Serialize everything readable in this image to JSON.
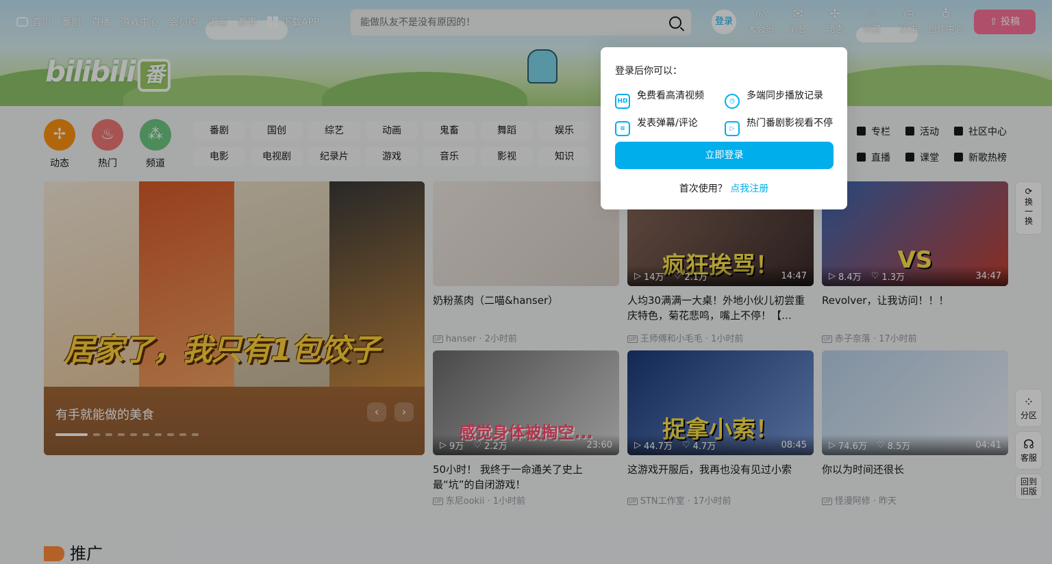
{
  "nav": {
    "home": "首页",
    "bangumi": "番剧",
    "live": "直播",
    "game": "游戏中心",
    "vipshop": "会员购",
    "manga": "漫画",
    "match": "赛事",
    "download": "下载APP"
  },
  "search": {
    "placeholder": "能做队友不是没有原因的！"
  },
  "right_nav": {
    "login": "登录",
    "vip": "大会员",
    "message": "消息",
    "dynamic": "动态",
    "favorite": "收藏",
    "history": "历史",
    "creator": "创作中心",
    "upload": "投稿"
  },
  "logo": {
    "text": "bilibili",
    "fan": "番"
  },
  "channels": [
    {
      "label": "动态",
      "color": "#ff9212"
    },
    {
      "label": "热门",
      "color": "#f07775"
    },
    {
      "label": "频道",
      "color": "#6dc781"
    }
  ],
  "tags": [
    "番剧",
    "国创",
    "综艺",
    "动画",
    "鬼畜",
    "舞蹈",
    "娱乐",
    "电影",
    "电视剧",
    "纪录片",
    "游戏",
    "音乐",
    "影视",
    "知识"
  ],
  "right_links": [
    "专栏",
    "活动",
    "社区中心",
    "直播",
    "课堂",
    "新歌热榜"
  ],
  "carousel": {
    "title": "有手就能做的美食",
    "caption": "居家了，我只有1包饺子"
  },
  "videos": [
    {
      "title": "奶粉蒸肉（二喵&hanser）",
      "author": "hanser",
      "time": "2小时前",
      "plays": "",
      "likes": "",
      "duration": "",
      "caption": ""
    },
    {
      "title": "人均30满满一大桌！外地小伙儿初尝重庆特色，菊花悲鸣，嘴上不停！【…",
      "author": "王师傅和小毛毛",
      "time": "1小时前",
      "plays": "14万",
      "likes": "2.1万",
      "duration": "14:47",
      "caption": "疯狂挨骂！"
    },
    {
      "title": "Revolver，让我访问！！！",
      "author": "赤子奈落",
      "time": "17小时前",
      "plays": "8.4万",
      "likes": "1.3万",
      "duration": "34:47",
      "caption": "VS"
    },
    {
      "title": "50小时！ 我终于一命通关了史上最“坑”的自闭游戏！",
      "author": "东尼ookii",
      "time": "1小时前",
      "plays": "9万",
      "likes": "2.2万",
      "duration": "23:60",
      "caption": "感觉身体被掏空..."
    },
    {
      "title": "这游戏开服后，我再也没有见过小索",
      "author": "STN工作室",
      "time": "17小时前",
      "plays": "44.7万",
      "likes": "4.7万",
      "duration": "08:45",
      "caption": "捉拿小索！"
    },
    {
      "title": "你以为时间还很长",
      "author": "怪漫阿修",
      "time": "昨天",
      "plays": "74.6万",
      "likes": "8.5万",
      "duration": "04:41",
      "caption": ""
    }
  ],
  "popup": {
    "header": "登录后你可以：",
    "items": [
      "免费看高清视频",
      "多端同步播放记录",
      "发表弹幕/评论",
      "热门番剧影视看不停"
    ],
    "button": "立即登录",
    "first_use": "首次使用？",
    "register": "点我注册"
  },
  "sidebar": {
    "refresh": "换一换",
    "zone": "分区",
    "service": "客服",
    "old": "回到旧版"
  },
  "promo": "推广"
}
